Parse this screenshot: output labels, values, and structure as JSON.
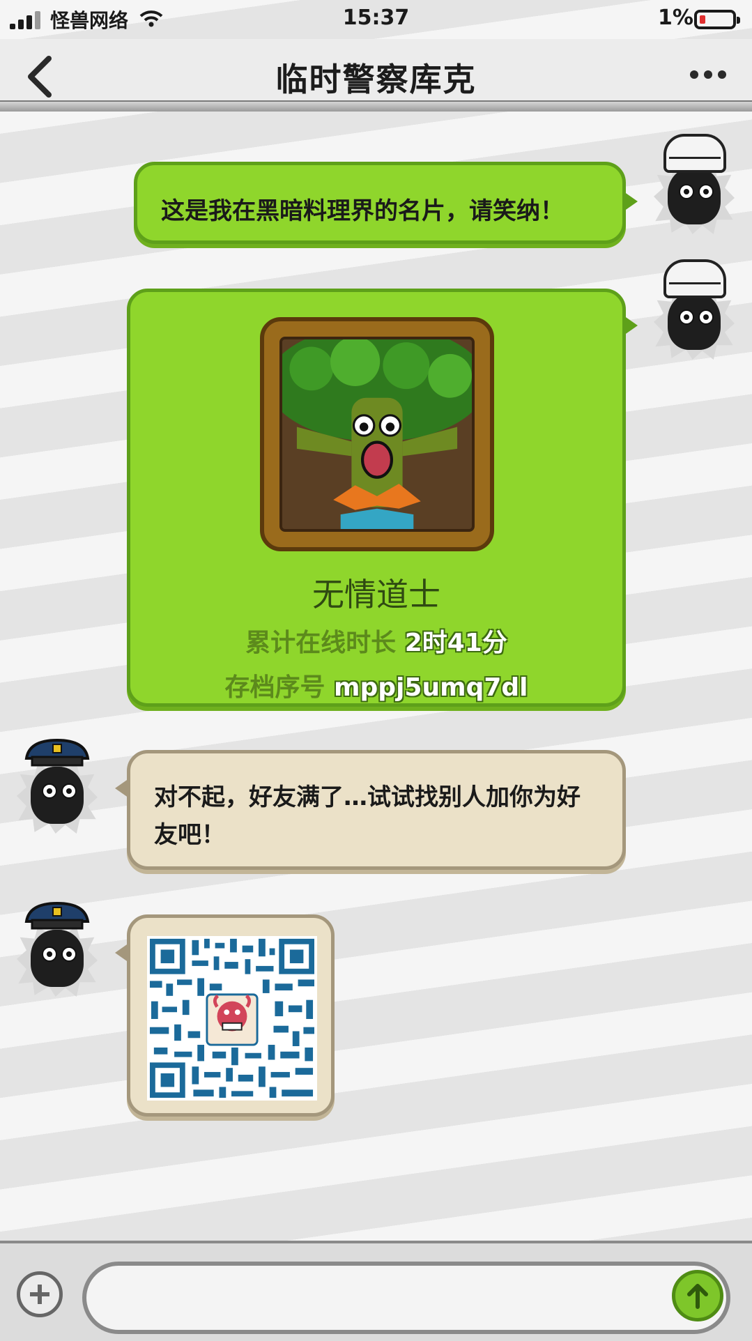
{
  "status_bar": {
    "carrier": "怪兽网络",
    "time": "15:37",
    "battery_pct": "1%",
    "battery_level": 0.01
  },
  "header": {
    "title": "临时警察库克",
    "back_icon": "chevron-left-icon",
    "more_icon": "ellipsis-icon"
  },
  "messages": [
    {
      "sender": "self",
      "avatar": "chef-monster-avatar",
      "text": "这是我在黑暗料理界的名片，请笑纳！"
    },
    {
      "sender": "self",
      "avatar": "chef-monster-avatar",
      "card": {
        "image": "tree-monster-portrait",
        "name": "无情道士",
        "online_label": "累计在线时长",
        "online_value": "2时41分",
        "save_label": "存档序号",
        "save_value": "mppj5umq7dl"
      }
    },
    {
      "sender": "other",
      "avatar": "police-monster-avatar",
      "text": "对不起，好友满了…试试找别人加你为好友吧！"
    },
    {
      "sender": "other",
      "avatar": "police-monster-avatar",
      "image": "qr-code"
    }
  ],
  "input_bar": {
    "plus_icon": "plus-circle-icon",
    "send_icon": "arrow-up-icon",
    "value": ""
  },
  "colors": {
    "green_bubble": "#8fd62c",
    "beige_bubble": "#ebe1c8",
    "send_button": "#7ec62a"
  }
}
